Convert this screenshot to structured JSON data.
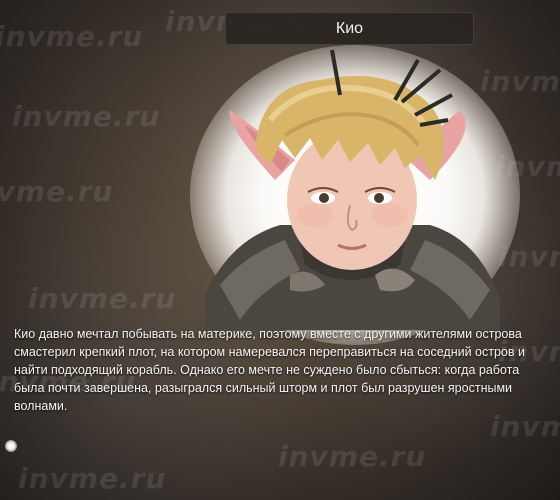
{
  "dialog": {
    "title": "Кио",
    "description": "Кио давно мечтал побывать на материке, поэтому вместе с другими жителями острова смастерил крепкий плот, на котором намеревался переправиться на соседний остров и найти подходящий корабль. Однако его мечте не суждено было сбыться: когда работа была почти завершена, разыгрался сильный шторм и плот был разрушен яростными волнами."
  },
  "watermark": {
    "text": "invme.ru"
  },
  "colors": {
    "title_bar_bg": "#28241f",
    "text": "#f4f4f4",
    "background": "#4b4036",
    "hair": "#d9b56a",
    "skin": "#efc7b4"
  },
  "portrait": {
    "icon": "character-portrait-kio"
  }
}
